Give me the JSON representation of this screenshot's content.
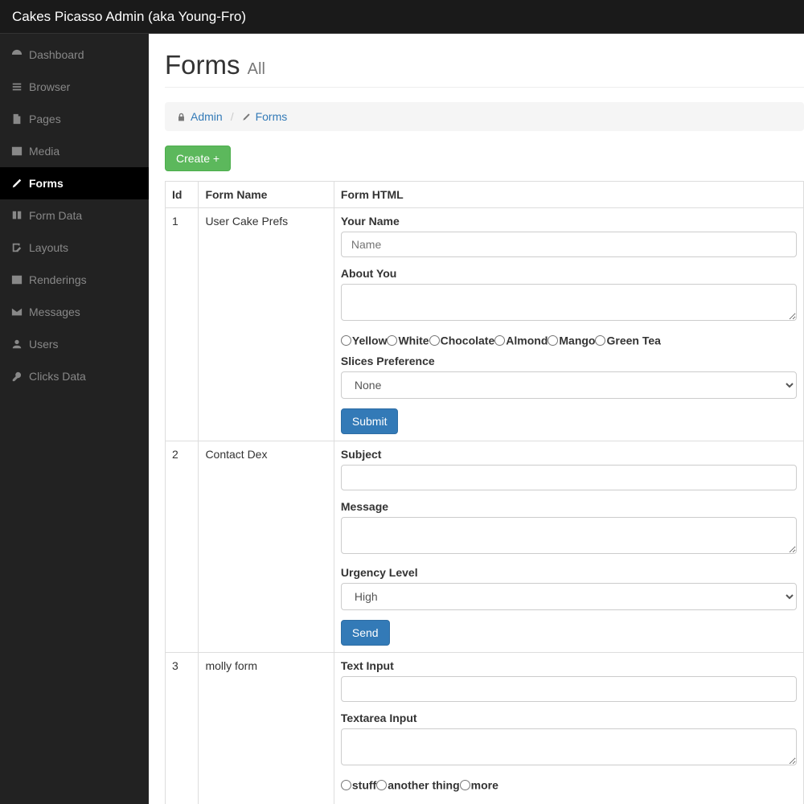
{
  "app_title": "Cakes Picasso Admin (aka Young-Fro)",
  "sidebar": {
    "items": [
      {
        "label": "Dashboard",
        "icon": "dashboard"
      },
      {
        "label": "Browser",
        "icon": "list"
      },
      {
        "label": "Pages",
        "icon": "file"
      },
      {
        "label": "Media",
        "icon": "image"
      },
      {
        "label": "Forms",
        "icon": "pencil",
        "active": true
      },
      {
        "label": "Form Data",
        "icon": "book"
      },
      {
        "label": "Layouts",
        "icon": "edit"
      },
      {
        "label": "Renderings",
        "icon": "image"
      },
      {
        "label": "Messages",
        "icon": "envelope"
      },
      {
        "label": "Users",
        "icon": "user"
      },
      {
        "label": "Clicks Data",
        "icon": "key"
      }
    ]
  },
  "page": {
    "title": "Forms",
    "subtitle": "All"
  },
  "breadcrumb": {
    "admin": "Admin",
    "current": "Forms"
  },
  "create_button": "Create +",
  "table": {
    "headers": {
      "id": "Id",
      "name": "Form Name",
      "html": "Form HTML"
    },
    "rows": [
      {
        "id": "1",
        "name": "User Cake Prefs",
        "form": {
          "name_label": "Your Name",
          "name_placeholder": "Name",
          "about_label": "About You",
          "radios": [
            "Yellow",
            "White",
            "Chocolate",
            "Almond",
            "Mango",
            "Green Tea"
          ],
          "slices_label": "Slices Preference",
          "slices_value": "None",
          "submit": "Submit"
        }
      },
      {
        "id": "2",
        "name": "Contact Dex",
        "form": {
          "subject_label": "Subject",
          "message_label": "Message",
          "urgency_label": "Urgency Level",
          "urgency_value": "High",
          "submit": "Send"
        }
      },
      {
        "id": "3",
        "name": "molly form",
        "form": {
          "text_label": "Text Input",
          "textarea_label": "Textarea Input",
          "radios": [
            "stuff",
            "another thing",
            "more"
          ]
        }
      }
    ]
  }
}
